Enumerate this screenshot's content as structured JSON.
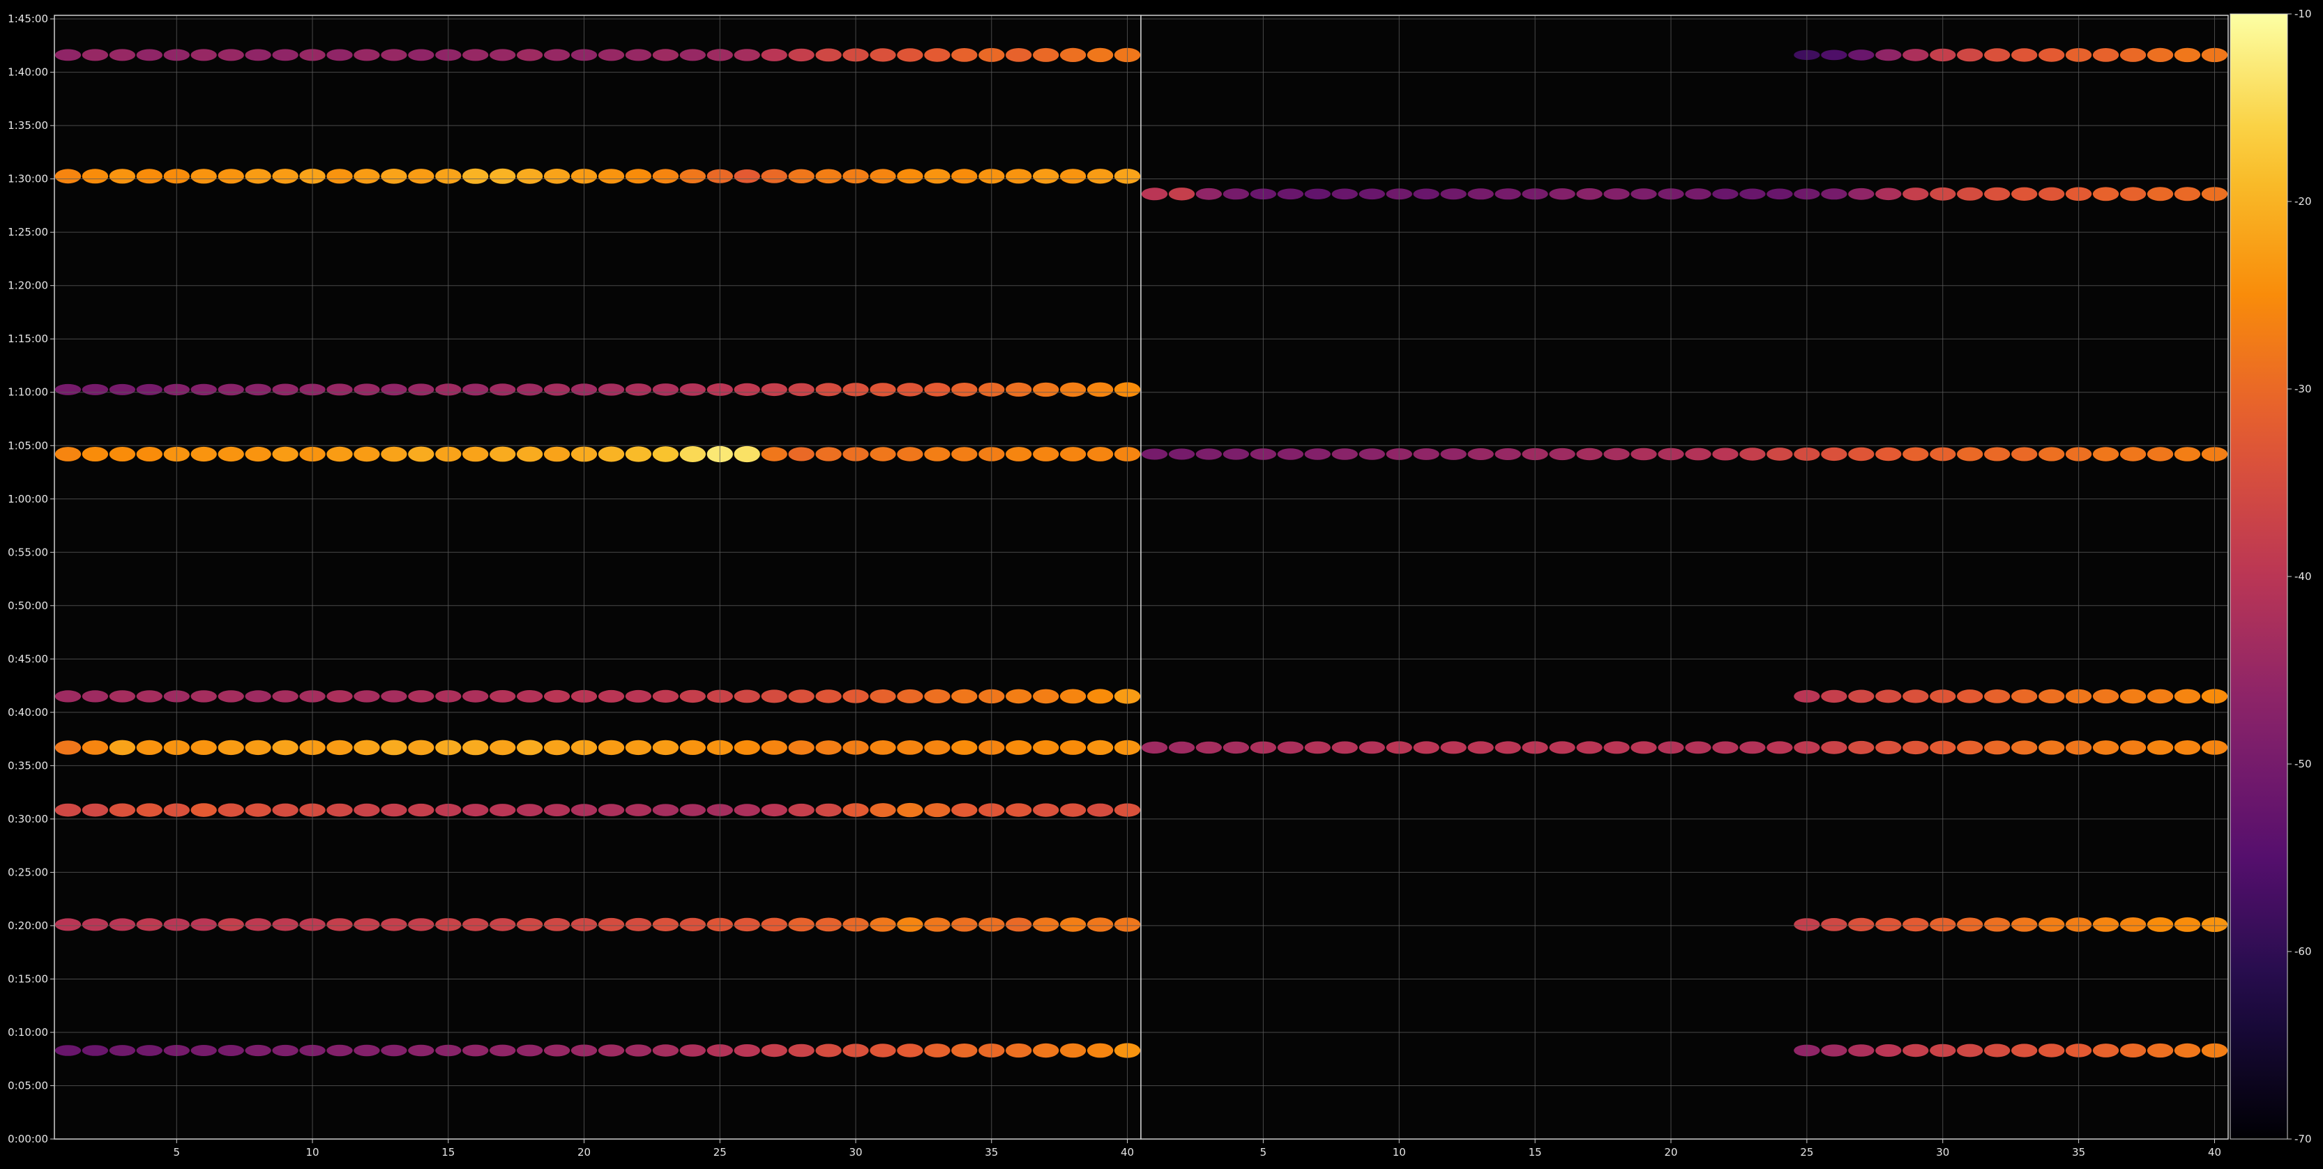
{
  "chart_data": {
    "type": "heatmap",
    "title": "",
    "xlabel": "",
    "ylabel": "",
    "panels": [
      {
        "id": "left",
        "x_range": [
          1,
          40
        ],
        "x_ticks": [
          5,
          10,
          15,
          20,
          25,
          30,
          35,
          40
        ],
        "bands": [
          {
            "t": 6097,
            "x_start": 1,
            "x_end": 40,
            "values": [
              -46,
              -45,
              -45,
              -46,
              -46,
              -45,
              -45,
              -46,
              -46,
              -45,
              -46,
              -45,
              -45,
              -46,
              -46,
              -45,
              -45,
              -44,
              -45,
              -46,
              -45,
              -45,
              -44,
              -45,
              -44,
              -43,
              -40,
              -38,
              -36,
              -35,
              -34,
              -33,
              -32,
              -31,
              -30,
              -31,
              -30,
              -29,
              -28,
              -28
            ]
          },
          {
            "t": 5415,
            "x_start": 1,
            "x_end": 40,
            "values": [
              -26,
              -25,
              -24,
              -25,
              -25,
              -24,
              -24,
              -23,
              -23,
              -22,
              -24,
              -23,
              -22,
              -23,
              -22,
              -20,
              -20,
              -21,
              -22,
              -23,
              -24,
              -25,
              -26,
              -28,
              -30,
              -32,
              -30,
              -28,
              -27,
              -27,
              -26,
              -25,
              -24,
              -25,
              -24,
              -24,
              -23,
              -24,
              -23,
              -22
            ]
          },
          {
            "t": 3852,
            "x_start": 1,
            "x_end": 40,
            "values": [
              -26,
              -25,
              -25,
              -25,
              -24,
              -24,
              -24,
              -24,
              -23,
              -24,
              -23,
              -23,
              -22,
              -21,
              -22,
              -22,
              -21,
              -21,
              -22,
              -21,
              -20,
              -19,
              -18,
              -15,
              -13,
              -14,
              -28,
              -30,
              -29,
              -29,
              -28,
              -28,
              -27,
              -27,
              -27,
              -26,
              -26,
              -26,
              -26,
              -26
            ]
          },
          {
            "t": 4215,
            "x_start": 1,
            "x_end": 40,
            "values": [
              -50,
              -50,
              -50,
              -50,
              -48,
              -48,
              -47,
              -47,
              -46,
              -46,
              -45,
              -45,
              -46,
              -45,
              -44,
              -45,
              -44,
              -44,
              -43,
              -44,
              -43,
              -42,
              -42,
              -41,
              -40,
              -39,
              -38,
              -37,
              -35,
              -34,
              -33,
              -33,
              -32,
              -31,
              -30,
              -29,
              -28,
              -27,
              -26,
              -25
            ]
          },
          {
            "t": 2202,
            "x_start": 1,
            "x_end": 40,
            "values": [
              -28,
              -26,
              -22,
              -24,
              -24,
              -24,
              -23,
              -23,
              -22,
              -23,
              -23,
              -22,
              -21,
              -22,
              -21,
              -21,
              -22,
              -21,
              -22,
              -22,
              -23,
              -23,
              -23,
              -24,
              -24,
              -25,
              -26,
              -27,
              -27,
              -27,
              -26,
              -26,
              -26,
              -25,
              -26,
              -25,
              -25,
              -25,
              -24,
              -24
            ]
          },
          {
            "t": 2490,
            "x_start": 1,
            "x_end": 40,
            "values": [
              -44,
              -44,
              -43,
              -43,
              -44,
              -43,
              -43,
              -44,
              -43,
              -43,
              -42,
              -43,
              -43,
              -42,
              -42,
              -42,
              -41,
              -41,
              -40,
              -40,
              -40,
              -40,
              -39,
              -38,
              -37,
              -36,
              -35,
              -34,
              -33,
              -32,
              -31,
              -30,
              -29,
              -28,
              -28,
              -27,
              -27,
              -26,
              -25,
              -23
            ]
          },
          {
            "t": 1850,
            "x_start": 1,
            "x_end": 40,
            "values": [
              -36,
              -36,
              -34,
              -33,
              -34,
              -32,
              -34,
              -34,
              -35,
              -35,
              -36,
              -37,
              -38,
              -38,
              -39,
              -40,
              -40,
              -41,
              -41,
              -42,
              -42,
              -42,
              -43,
              -43,
              -43,
              -42,
              -40,
              -38,
              -36,
              -32,
              -30,
              -28,
              -30,
              -32,
              -33,
              -33,
              -34,
              -34,
              -35,
              -34
            ]
          },
          {
            "t": 1206,
            "x_start": 1,
            "x_end": 40,
            "values": [
              -40,
              -40,
              -40,
              -39,
              -40,
              -40,
              -38,
              -39,
              -39,
              -39,
              -38,
              -38,
              -38,
              -38,
              -37,
              -37,
              -37,
              -36,
              -36,
              -36,
              -35,
              -35,
              -34,
              -34,
              -33,
              -33,
              -32,
              -31,
              -31,
              -30,
              -28,
              -26,
              -28,
              -29,
              -29,
              -30,
              -28,
              -27,
              -28,
              -28
            ]
          },
          {
            "t": 498,
            "x_start": 1,
            "x_end": 40,
            "values": [
              -52,
              -52,
              -51,
              -51,
              -50,
              -50,
              -50,
              -49,
              -49,
              -49,
              -48,
              -48,
              -48,
              -47,
              -47,
              -46,
              -46,
              -46,
              -45,
              -45,
              -44,
              -44,
              -43,
              -42,
              -41,
              -40,
              -38,
              -37,
              -35,
              -34,
              -33,
              -32,
              -31,
              -30,
              -30,
              -29,
              -28,
              -27,
              -26,
              -24
            ]
          }
        ]
      },
      {
        "id": "right",
        "x_range": [
          1,
          40
        ],
        "x_ticks": [
          5,
          10,
          15,
          20,
          25,
          30,
          35,
          40
        ],
        "bands": [
          {
            "t": 6097,
            "x_start": 25,
            "x_end": 40,
            "values": [
              -58,
              -56,
              -52,
              -46,
              -42,
              -38,
              -36,
              -34,
              -33,
              -32,
              -31,
              -31,
              -30,
              -29,
              -28,
              -28
            ]
          },
          {
            "t": 5315,
            "x_start": 1,
            "x_end": 40,
            "values": [
              -40,
              -38,
              -46,
              -50,
              -52,
              -52,
              -53,
              -52,
              -52,
              -51,
              -52,
              -51,
              -50,
              -50,
              -50,
              -48,
              -47,
              -48,
              -49,
              -50,
              -50,
              -52,
              -52,
              -52,
              -51,
              -50,
              -46,
              -42,
              -38,
              -36,
              -35,
              -34,
              -33,
              -33,
              -32,
              -31,
              -31,
              -30,
              -30,
              -29
            ]
          },
          {
            "t": 3852,
            "x_start": 1,
            "x_end": 40,
            "values": [
              -50,
              -50,
              -49,
              -49,
              -48,
              -48,
              -48,
              -47,
              -47,
              -46,
              -46,
              -46,
              -45,
              -45,
              -44,
              -44,
              -43,
              -43,
              -42,
              -42,
              -41,
              -40,
              -38,
              -36,
              -35,
              -34,
              -33,
              -32,
              -31,
              -31,
              -30,
              -30,
              -30,
              -29,
              -29,
              -28,
              -28,
              -28,
              -27,
              -27
            ]
          },
          {
            "t": 2202,
            "x_start": 1,
            "x_end": 40,
            "values": [
              -44,
              -44,
              -43,
              -43,
              -42,
              -42,
              -41,
              -41,
              -41,
              -40,
              -40,
              -40,
              -40,
              -40,
              -40,
              -40,
              -40,
              -40,
              -40,
              -41,
              -41,
              -41,
              -41,
              -40,
              -39,
              -37,
              -35,
              -34,
              -33,
              -32,
              -31,
              -30,
              -29,
              -28,
              -28,
              -27,
              -27,
              -26,
              -26,
              -26
            ]
          },
          {
            "t": 2490,
            "x_start": 25,
            "x_end": 40,
            "values": [
              -40,
              -38,
              -36,
              -35,
              -34,
              -33,
              -32,
              -31,
              -30,
              -29,
              -28,
              -28,
              -27,
              -27,
              -26,
              -25
            ]
          },
          {
            "t": 1206,
            "x_start": 25,
            "x_end": 40,
            "values": [
              -38,
              -36,
              -34,
              -33,
              -32,
              -31,
              -30,
              -29,
              -28,
              -27,
              -27,
              -26,
              -26,
              -25,
              -25,
              -24
            ]
          },
          {
            "t": 498,
            "x_start": 25,
            "x_end": 40,
            "values": [
              -46,
              -44,
              -42,
              -40,
              -38,
              -37,
              -36,
              -35,
              -34,
              -33,
              -32,
              -31,
              -30,
              -29,
              -28,
              -27
            ]
          }
        ]
      }
    ],
    "y_ticks": [
      {
        "value": 0,
        "label": "0:00:00"
      },
      {
        "value": 300,
        "label": "0:05:00"
      },
      {
        "value": 600,
        "label": "0:10:00"
      },
      {
        "value": 900,
        "label": "0:15:00"
      },
      {
        "value": 1200,
        "label": "0:20:00"
      },
      {
        "value": 1500,
        "label": "0:25:00"
      },
      {
        "value": 1800,
        "label": "0:30:00"
      },
      {
        "value": 2100,
        "label": "0:35:00"
      },
      {
        "value": 2400,
        "label": "0:40:00"
      },
      {
        "value": 2700,
        "label": "0:45:00"
      },
      {
        "value": 3000,
        "label": "0:50:00"
      },
      {
        "value": 3300,
        "label": "0:55:00"
      },
      {
        "value": 3600,
        "label": "1:00:00"
      },
      {
        "value": 3900,
        "label": "1:05:00"
      },
      {
        "value": 4200,
        "label": "1:10:00"
      },
      {
        "value": 4500,
        "label": "1:15:00"
      },
      {
        "value": 4800,
        "label": "1:20:00"
      },
      {
        "value": 5100,
        "label": "1:25:00"
      },
      {
        "value": 5400,
        "label": "1:30:00"
      },
      {
        "value": 5700,
        "label": "1:35:00"
      },
      {
        "value": 6000,
        "label": "1:40:00"
      },
      {
        "value": 6300,
        "label": "1:45:00"
      }
    ],
    "ylim": [
      0,
      6320
    ],
    "colorbar": {
      "colormap": "inferno",
      "range": [
        -70,
        -10
      ],
      "ticks": [
        -10,
        -20,
        -30,
        -40,
        -50,
        -60,
        -70
      ]
    },
    "grid": true,
    "background": "#000000",
    "grid_color": "#5a5a5a",
    "text_color": "#e6e6e6"
  }
}
